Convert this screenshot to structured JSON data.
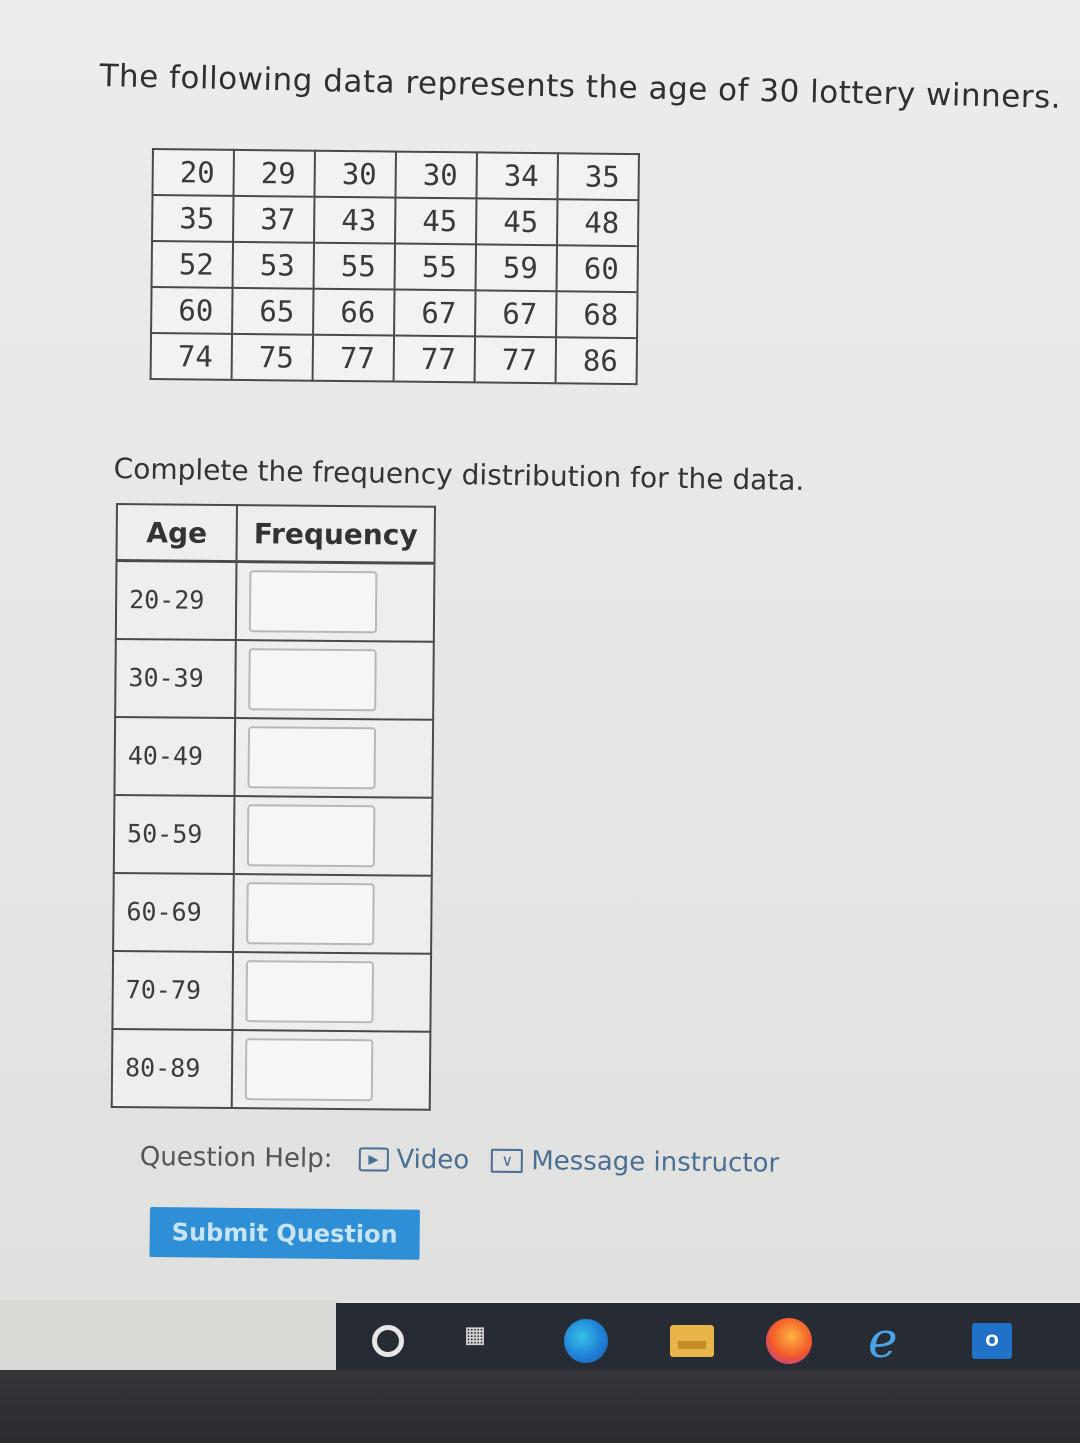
{
  "question": {
    "title": "The following data represents the age of 30 lottery winners.",
    "data_rows": [
      [
        "20",
        "29",
        "30",
        "30",
        "34",
        "35"
      ],
      [
        "35",
        "37",
        "43",
        "45",
        "45",
        "48"
      ],
      [
        "52",
        "53",
        "55",
        "55",
        "59",
        "60"
      ],
      [
        "60",
        "65",
        "66",
        "67",
        "67",
        "68"
      ],
      [
        "74",
        "75",
        "77",
        "77",
        "77",
        "86"
      ]
    ],
    "instruction": "Complete the frequency distribution for the data."
  },
  "frequency_table": {
    "headers": {
      "age": "Age",
      "frequency": "Frequency"
    },
    "rows": [
      {
        "range": "20-29",
        "value": ""
      },
      {
        "range": "30-39",
        "value": ""
      },
      {
        "range": "40-49",
        "value": ""
      },
      {
        "range": "50-59",
        "value": ""
      },
      {
        "range": "60-69",
        "value": ""
      },
      {
        "range": "70-79",
        "value": ""
      },
      {
        "range": "80-89",
        "value": ""
      }
    ]
  },
  "help": {
    "label": "Question Help:",
    "video": "Video",
    "message": "Message instructor"
  },
  "submit_label": "Submit Question",
  "taskbar": {
    "icons": [
      "search-icon",
      "task-view-icon",
      "edge-icon",
      "file-explorer-icon",
      "firefox-icon",
      "internet-explorer-icon",
      "outlook-icon"
    ],
    "ie_glyph": "e",
    "outlook_glyph": "O"
  }
}
